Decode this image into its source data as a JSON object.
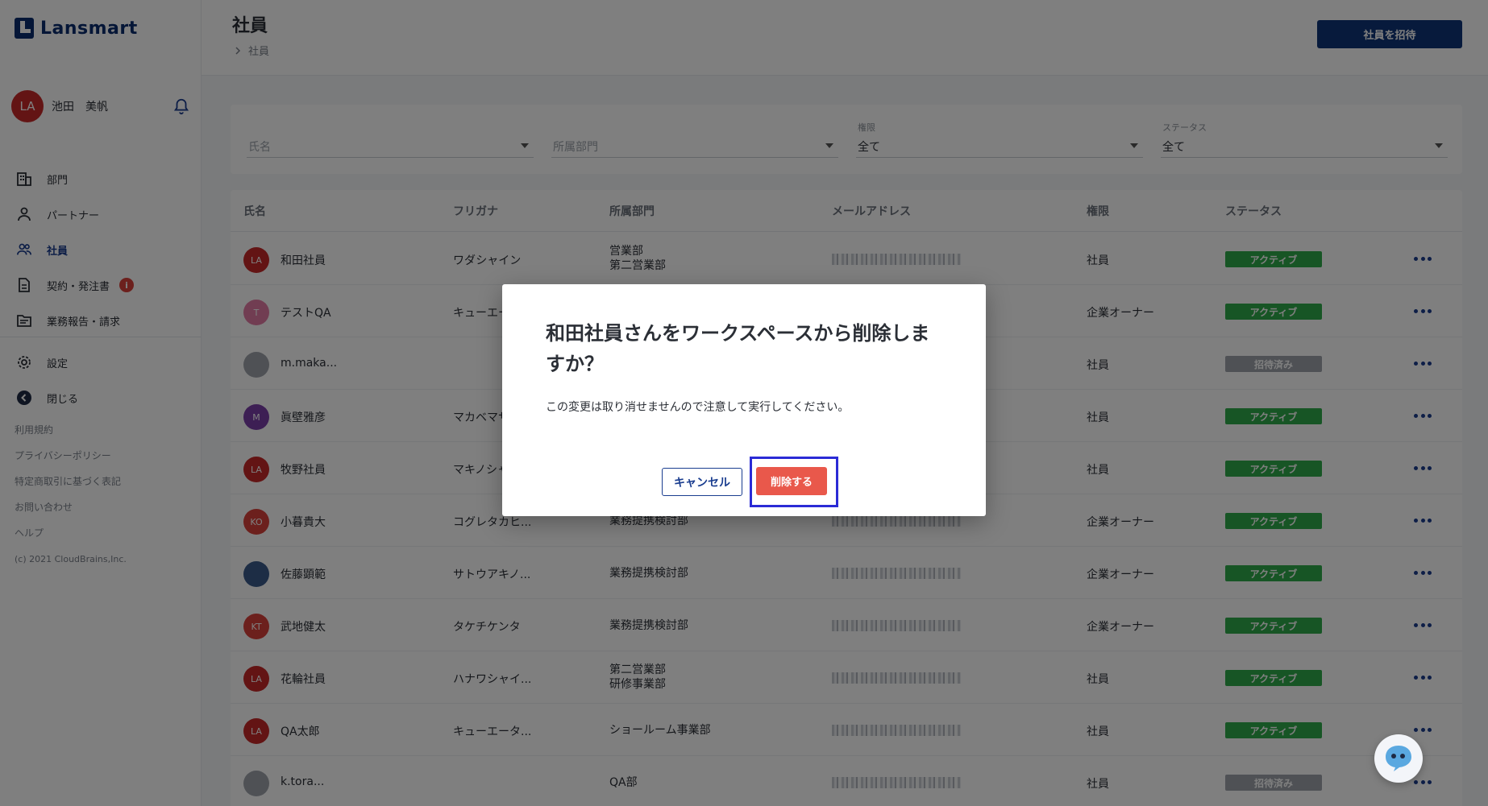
{
  "app": {
    "name": "Lansmart"
  },
  "user": {
    "initials": "LA",
    "name": "池田　美帆"
  },
  "sidebar": {
    "items": [
      {
        "label": "部門",
        "icon": "building-icon"
      },
      {
        "label": "パートナー",
        "icon": "person-icon"
      },
      {
        "label": "社員",
        "icon": "people-icon",
        "active": true
      },
      {
        "label": "契約・発注書",
        "icon": "document-icon",
        "badge": "i"
      },
      {
        "label": "業務報告・請求",
        "icon": "folder-icon"
      }
    ],
    "secondary": [
      {
        "label": "設定",
        "icon": "gear-icon"
      },
      {
        "label": "閉じる",
        "icon": "arrow-left-icon"
      }
    ],
    "links": [
      "利用規約",
      "プライバシーポリシー",
      "特定商取引に基づく表記",
      "お問い合わせ",
      "ヘルプ"
    ],
    "copyright": "(c) 2021 CloudBrains,Inc."
  },
  "header": {
    "title": "社員",
    "breadcrumb": "社員",
    "invite_label": "社員を招待"
  },
  "filters": {
    "name_placeholder": "氏名",
    "dept_placeholder": "所属部門",
    "role_label": "権限",
    "role_value": "全て",
    "status_label": "ステータス",
    "status_value": "全て"
  },
  "table": {
    "columns": [
      "氏名",
      "フリガナ",
      "所属部門",
      "メールアドレス",
      "権限",
      "ステータス"
    ],
    "rows": [
      {
        "initials": "LA",
        "avatar_color": "#c62828",
        "name": "和田社員",
        "kana": "ワダシャイン",
        "dept": [
          "営業部",
          "第二営業部"
        ],
        "role": "社員",
        "status": "アクティブ",
        "status_type": "active"
      },
      {
        "initials": "T",
        "avatar_color": "#e37ba4",
        "name": "テストQA",
        "kana": "キューエー",
        "dept": [],
        "role": "企業オーナー",
        "status": "アクティブ",
        "status_type": "active"
      },
      {
        "initials": "",
        "avatar_color": "#9ea3ab",
        "name": "m.maka...",
        "kana": "",
        "dept": [],
        "role": "社員",
        "status": "招待済み",
        "status_type": "invited"
      },
      {
        "initials": "M",
        "avatar_color": "#7b3fa8",
        "name": "眞壁雅彦",
        "kana": "マカベマサ",
        "dept": [],
        "role": "社員",
        "status": "アクティブ",
        "status_type": "active"
      },
      {
        "initials": "LA",
        "avatar_color": "#c62828",
        "name": "牧野社員",
        "kana": "マキノシャ",
        "dept": [],
        "role": "社員",
        "status": "アクティブ",
        "status_type": "active"
      },
      {
        "initials": "KO",
        "avatar_color": "#d9403a",
        "name": "小暮貴大",
        "kana": "コグレタカヒ...",
        "dept": [
          "業務提携検討部"
        ],
        "role": "企業オーナー",
        "status": "アクティブ",
        "status_type": "active"
      },
      {
        "initials": "",
        "avatar_color": "#3a5a8a",
        "name": "佐藤顕範",
        "kana": "サトウアキノ...",
        "dept": [
          "業務提携検討部"
        ],
        "role": "企業オーナー",
        "status": "アクティブ",
        "status_type": "active"
      },
      {
        "initials": "KT",
        "avatar_color": "#d9403a",
        "name": "武地健太",
        "kana": "タケチケンタ",
        "dept": [
          "業務提携検討部"
        ],
        "role": "企業オーナー",
        "status": "アクティブ",
        "status_type": "active"
      },
      {
        "initials": "LA",
        "avatar_color": "#c62828",
        "name": "花輪社員",
        "kana": "ハナワシャイ...",
        "dept": [
          "第二営業部",
          "研修事業部"
        ],
        "role": "社員",
        "status": "アクティブ",
        "status_type": "active"
      },
      {
        "initials": "LA",
        "avatar_color": "#c62828",
        "name": "QA太郎",
        "kana": "キューエータ...",
        "dept": [
          "ショールーム事業部"
        ],
        "role": "社員",
        "status": "アクティブ",
        "status_type": "active"
      },
      {
        "initials": "",
        "avatar_color": "#9ea3ab",
        "name": "k.tora...",
        "kana": "",
        "dept": [
          "QA部"
        ],
        "role": "社員",
        "status": "招待済み",
        "status_type": "invited"
      }
    ]
  },
  "dialog": {
    "title": "和田社員さんをワークスペースから削除しますか？",
    "message": "この変更は取り消せませんので注意して実行してください。",
    "cancel_label": "キャンセル",
    "delete_label": "削除する"
  },
  "colors": {
    "primary": "#0e3578",
    "active": "#2faa4a",
    "invited": "#9ea3ab",
    "danger": "#e9584b"
  }
}
